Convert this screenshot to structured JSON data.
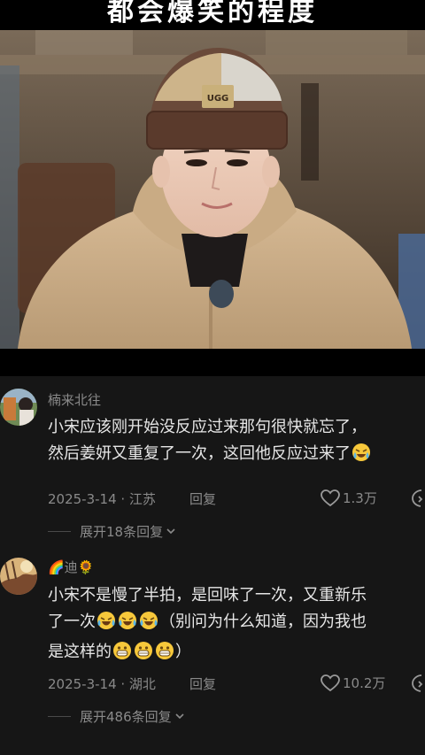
{
  "video": {
    "caption": "都会爆笑的程度",
    "beanie_label": "UGG"
  },
  "comments": [
    {
      "username": "楠来北往",
      "lines": [
        "小宋应该刚开始没反应过来那句很快就忘了，",
        "然后姜妍又重复了一次，这回他反应过来了"
      ],
      "date_location": "2025-3-14 · 江苏",
      "reply_label": "回复",
      "likes": "1.3万",
      "expand_label": "展开18条回复"
    },
    {
      "username": "🌈迪🌻",
      "lines": [
        "小宋不是慢了半拍，是回味了一次，又重新乐",
        "了一次",
        "（别问为什么知道，因为我也",
        "是这样的",
        "）"
      ],
      "date_location": "2025-3-14 · 湖北",
      "reply_label": "回复",
      "likes": "10.2万",
      "expand_label": "展开486条回复"
    }
  ],
  "colors": {
    "background": "#161616",
    "text_primary": "#e6e6e6",
    "text_secondary": "#8a8a8a"
  },
  "icons": [
    "heart-icon",
    "dislike-icon",
    "chevron-down-icon",
    "crying-laughing-emoji",
    "laughing-crying-emoji",
    "grinning-emoji"
  ]
}
